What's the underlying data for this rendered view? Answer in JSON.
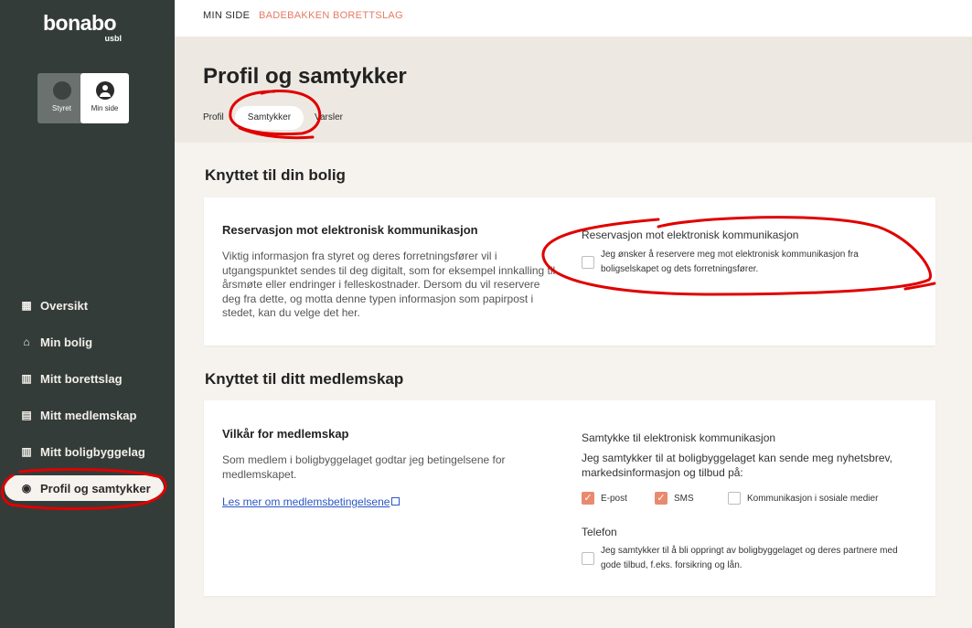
{
  "brand": {
    "name": "bonabo",
    "sub": "usbl"
  },
  "roles": [
    {
      "label": "Styret",
      "icon": "team-icon"
    },
    {
      "label": "Min side",
      "icon": "user-icon"
    }
  ],
  "nav": [
    {
      "label": "Oversikt",
      "icon": "grid-icon",
      "glyph": "▦"
    },
    {
      "label": "Min bolig",
      "icon": "home-icon",
      "glyph": "⌂"
    },
    {
      "label": "Mitt borettslag",
      "icon": "building-icon",
      "glyph": "▥"
    },
    {
      "label": "Mitt medlemskap",
      "icon": "id-card-icon",
      "glyph": "▤"
    },
    {
      "label": "Mitt boligbyggelag",
      "icon": "buildings-icon",
      "glyph": "▥"
    },
    {
      "label": "Profil og samtykker",
      "icon": "user-circle-icon",
      "glyph": "◉"
    }
  ],
  "breadcrumb": {
    "item1": "MIN SIDE",
    "item2": "BADEBAKKEN BORETTSLAG"
  },
  "page": {
    "title": "Profil og samtykker",
    "tabs": [
      "Profil",
      "Samtykker",
      "Varsler"
    ]
  },
  "bolig_section": {
    "title": "Knyttet til din bolig",
    "card_title": "Reservasjon mot elektronisk kommunikasjon",
    "text": "Viktig informasjon fra styret og deres forretningsfører vil i utgangspunktet sendes til deg digitalt, som for eksempel innkalling til årsmøte eller endringer i felleskostnader. Dersom du vil reservere deg fra dette, og motta denne typen informasjon som papirpost i stedet, kan du velge det her.",
    "option_title": "Reservasjon mot elektronisk kommunikasjon",
    "option_label": "Jeg ønsker å reservere meg mot elektronisk kommunikasjon fra boligselskapet og dets forretningsfører."
  },
  "medlemskap_section": {
    "title": "Knyttet til ditt medlemskap",
    "card_title": "Vilkår for medlemskap",
    "text": "Som medlem i boligbyggelaget godtar jeg betingelsene for medlemskapet.",
    "link": "Les mer om medlemsbetingelsene",
    "consent_title": "Samtykke til elektronisk kommunikasjon",
    "consent_text": "Jeg samtykker til at boligbyggelaget kan sende meg nyhetsbrev, markedsinformasjon og tilbud på:",
    "channels": [
      {
        "label": "E-post",
        "checked": true
      },
      {
        "label": "SMS",
        "checked": true
      },
      {
        "label": "Kommunikasjon i sosiale medier",
        "checked": false
      }
    ],
    "phone_title": "Telefon",
    "phone_label": "Jeg samtykker til å bli oppringt av boligbyggelaget og deres partnere med gode tilbud, f.eks. forsikring og lån."
  },
  "colors": {
    "sidebar": "#343c3a",
    "accent": "#e98a6f",
    "breadcrumb_accent": "#e57a65",
    "annotation": "#e00000"
  }
}
